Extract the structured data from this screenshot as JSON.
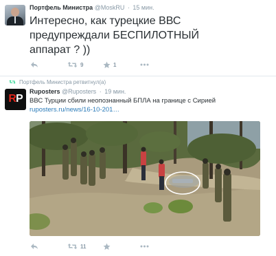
{
  "tweets": [
    {
      "author_name": "Портфель Министра",
      "author_handle": "@MoskRU",
      "time": "15 мин.",
      "text_lines": [
        "Интересно, как турецкие ВВС",
        "предупреждали БЕСПИЛОТНЫЙ",
        "аппарат ? ))"
      ],
      "retweets": "9",
      "likes": "1"
    },
    {
      "retweeted_by": "Портфель Министра ретвитнул(а)",
      "author_name": "Ruposters",
      "author_handle": "@Ruposters",
      "time": "19 мин.",
      "text": "ВВС Турции сбили неопознанный БПЛА на границе с Сирией",
      "link": "ruposters.ru/news/16-10-201…",
      "retweets": "11",
      "avatar_text": {
        "left": "R",
        "right": "P"
      }
    }
  ],
  "icons": {
    "reply": "reply-icon",
    "retweet": "retweet-icon",
    "like": "star-icon",
    "more": "more-dots-icon"
  },
  "colors": {
    "text": "#292f33",
    "muted": "#8899a6",
    "link": "#2b7bb9",
    "retweet_green": "#19cf86",
    "avatar_red": "#e1251b"
  }
}
